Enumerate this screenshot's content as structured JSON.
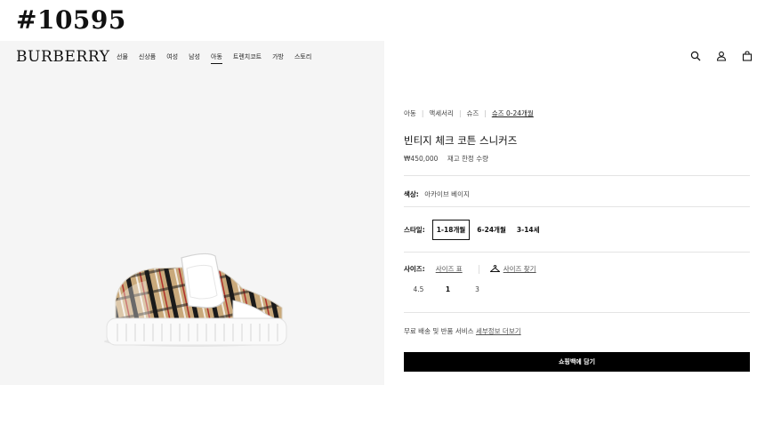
{
  "item_code": "#10595",
  "header": {
    "logo": "BURBERRY",
    "nav": [
      "선물",
      "신상품",
      "여성",
      "남성",
      "아동",
      "트렌치코트",
      "가방",
      "스토리"
    ],
    "active_nav": "아동",
    "icons": [
      "search-icon",
      "account-icon",
      "bag-icon"
    ]
  },
  "product": {
    "breadcrumb": [
      "아동",
      "액세서리",
      "슈즈",
      "슈즈 0-24개월"
    ],
    "title": "빈티지 체크 코튼 스니커즈",
    "price": "₩450,000",
    "stock_note": "재고 한정 수량",
    "color_label": "색상:",
    "color_value": "아카이브 베이지",
    "style_label": "스타일:",
    "styles": [
      "1-18개월",
      "6-24개월",
      "3-14세"
    ],
    "selected_style": "1-18개월",
    "size_label": "사이즈:",
    "size_chart_link": "사이즈 표",
    "size_finder_link": "사이즈 찾기",
    "sizes": [
      "4.5",
      "1",
      "3"
    ],
    "selected_size": "1",
    "service_text": "무료 배송 및 반품 서비스",
    "service_link": "세부정보 더보기",
    "add_to_bag": "쇼핑백에 담기"
  },
  "colors": {
    "accent": "#000000",
    "gallery_bg": "#f5f5f5",
    "check_beige": "#c9a97b"
  }
}
